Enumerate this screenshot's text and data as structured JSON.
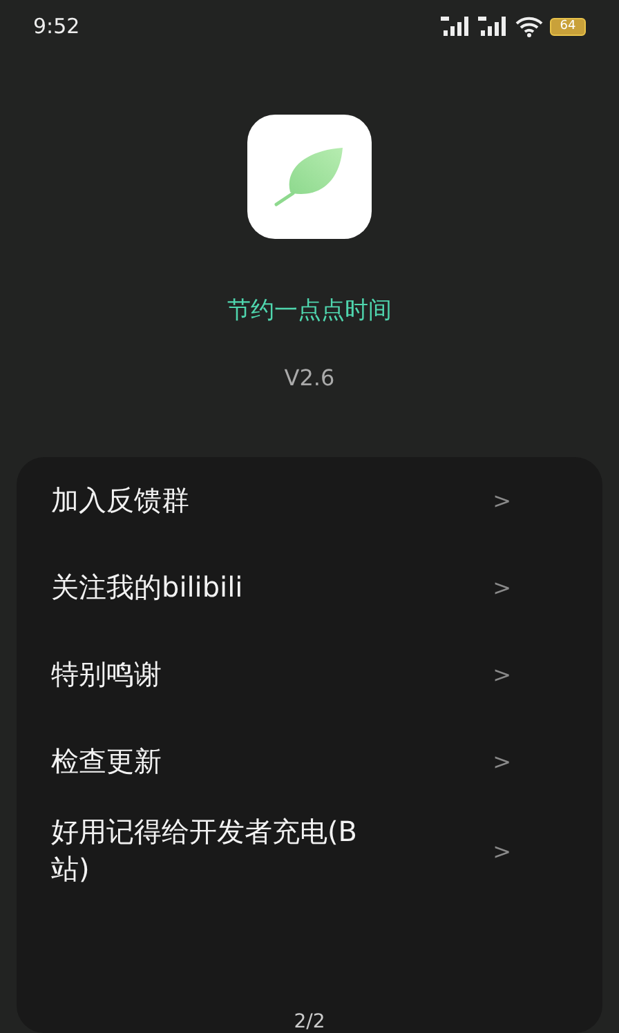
{
  "status_bar": {
    "time": "9:52",
    "battery": "64"
  },
  "app": {
    "name": "节约一点点时间",
    "version": "V2.6"
  },
  "menu": [
    {
      "label": "加入反馈群",
      "arrow": ">"
    },
    {
      "label": "关注我的bilibili",
      "arrow": ">"
    },
    {
      "label": "特别鸣谢",
      "arrow": ">"
    },
    {
      "label": "检查更新",
      "arrow": ">"
    },
    {
      "label": "好用记得给开发者充电(B站)",
      "arrow": ">"
    }
  ],
  "page_indicator": "2/2"
}
